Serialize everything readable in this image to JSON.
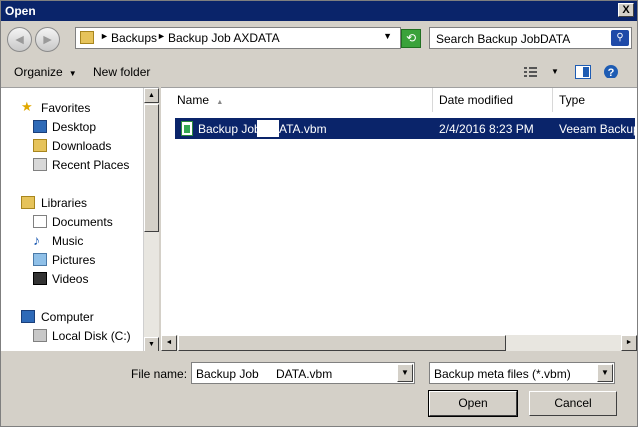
{
  "window": {
    "title": "Open",
    "close_glyph": "X"
  },
  "nav": {
    "back_glyph": "◄",
    "forward_glyph": "►",
    "breadcrumb": [
      "Backups",
      "Backup Job AXDATA"
    ],
    "search_placeholder": "Search Backup Job",
    "search_suffix": "DATA"
  },
  "toolbar": {
    "organize": "Organize",
    "new_folder": "New folder"
  },
  "sidebar": {
    "favorites": {
      "label": "Favorites",
      "items": [
        "Desktop",
        "Downloads",
        "Recent Places"
      ]
    },
    "libraries": {
      "label": "Libraries",
      "items": [
        "Documents",
        "Music",
        "Pictures",
        "Videos"
      ]
    },
    "computer": {
      "label": "Computer",
      "items": [
        "Local Disk (C:)"
      ]
    }
  },
  "files": {
    "columns": [
      "Name",
      "Date modified",
      "Type"
    ],
    "rows": [
      {
        "name_prefix": "Backup Job",
        "name_suffix": "ATA.vbm",
        "date": "2/4/2016 8:23 PM",
        "type": "Veeam Backup"
      }
    ]
  },
  "footer": {
    "file_name_label": "File name:",
    "file_name_prefix": "Backup Job",
    "file_name_suffix": "DATA.vbm",
    "filter": "Backup meta files (*.vbm)",
    "open": "Open",
    "cancel": "Cancel"
  }
}
